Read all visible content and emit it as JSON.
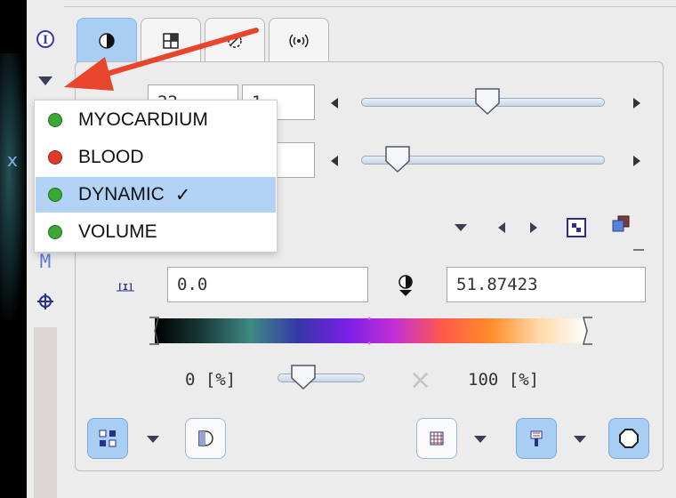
{
  "colors": {
    "accent_blue": "#a9cef4",
    "selection_blue": "#b3d3f6",
    "annotation_red": "#e8452c",
    "status_green": "#3aa833",
    "status_red": "#e23a2a"
  },
  "tabs": [
    {
      "icon": "contrast-icon",
      "active": true
    },
    {
      "icon": "grid-icon",
      "active": false
    },
    {
      "icon": "blend-icon",
      "active": false
    },
    {
      "icon": "wave-icon",
      "active": false
    }
  ],
  "toolbar_left": {
    "icons": [
      "info-icon",
      "dropdown-triangle-icon",
      "m-icon",
      "crosshair-icon"
    ],
    "m_label": "M"
  },
  "row1": {
    "field_a": "22",
    "field_b": "1",
    "slider_value": 0.52
  },
  "row2": {
    "field_b": "",
    "slider_value": 0.15
  },
  "left_overlay": {
    "x_mark": "x"
  },
  "range": {
    "min_value": "0.0",
    "max_value": "51.87423"
  },
  "colorbar": {
    "colors": [
      "#000000",
      "#1a3b3a",
      "#3f8a84",
      "#3437a8",
      "#7a1fe6",
      "#c42fd6",
      "#ff5a4a",
      "#ff8c28",
      "#ffd9a8",
      "#ffffff"
    ]
  },
  "percent": {
    "low": "0 [%]",
    "high": "100 [%]",
    "slider_value": 0.3
  },
  "dropdown": {
    "items": [
      {
        "label": "MYOCARDIUM",
        "color": "#3aa833",
        "selected": false,
        "check": ""
      },
      {
        "label": "BLOOD",
        "color": "#e23a2a",
        "selected": false,
        "check": ""
      },
      {
        "label": "DYNAMIC",
        "color": "#3aa833",
        "selected": true,
        "check": "✓"
      },
      {
        "label": "VOLUME",
        "color": "#3aa833",
        "selected": false,
        "check": ""
      }
    ]
  },
  "close_symbol": "×"
}
